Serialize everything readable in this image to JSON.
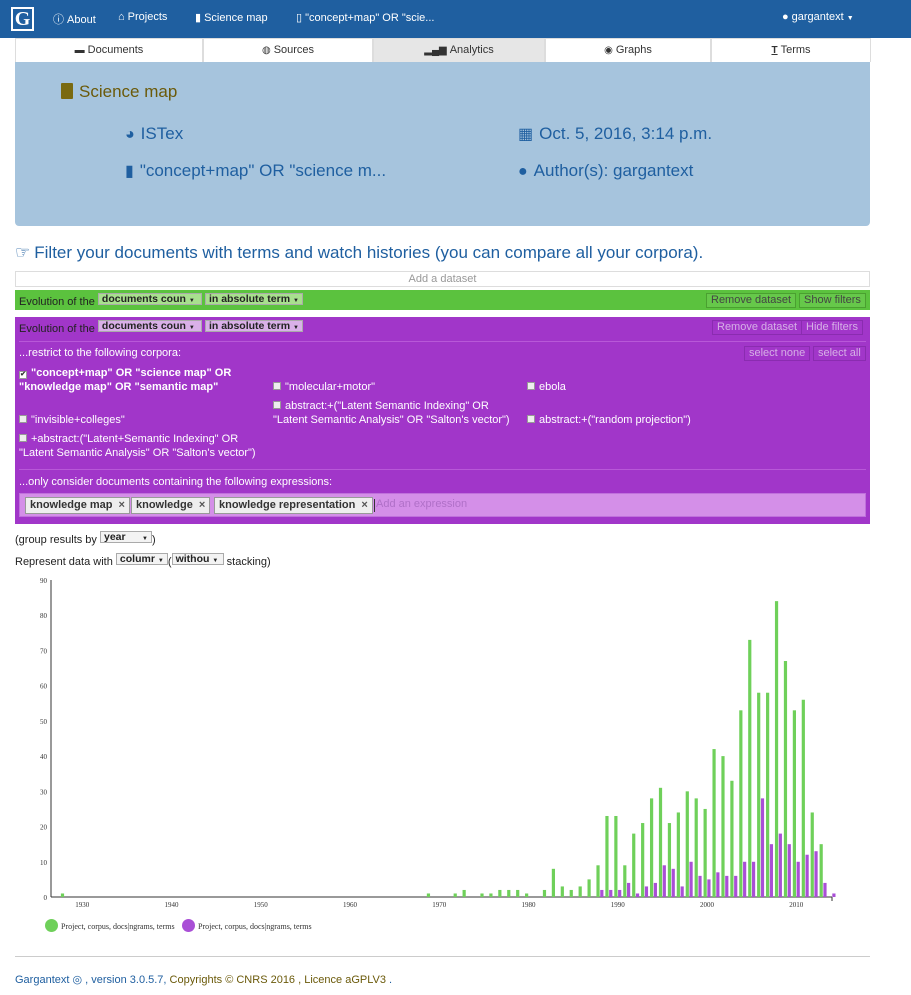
{
  "navbar": {
    "brand": "G",
    "about": "About",
    "projects": "Projects",
    "science_map": "Science map",
    "query": "\"concept+map\" OR \"scie...",
    "user": "gargantext"
  },
  "tabs": [
    {
      "label": "Documents",
      "icon": "folder-open-icon"
    },
    {
      "label": "Sources",
      "icon": "globe-icon"
    },
    {
      "label": "Analytics",
      "icon": "signal-icon"
    },
    {
      "label": "Graphs",
      "icon": "map-marker-icon"
    },
    {
      "label": "Terms",
      "icon": "text-icon"
    }
  ],
  "header": {
    "title": "Science map",
    "source": "ISTex",
    "date": "Oct. 5, 2016, 3:14 p.m.",
    "query": "\"concept+map\" OR \"science m...",
    "author": "Author(s): gargantext"
  },
  "filter": {
    "heading": "Filter your documents with terms and watch histories (you can compare all your corpora).",
    "add_dataset": "Add a dataset"
  },
  "dataset1": {
    "prefix": "Evolution of the",
    "measure": "documents coun",
    "mode": "in absolute term",
    "remove": "Remove dataset",
    "toggle": "Show filters",
    "color": "#5bc23e"
  },
  "dataset2": {
    "prefix": "Evolution of the",
    "measure": "documents coun",
    "mode": "in absolute term",
    "remove": "Remove dataset",
    "toggle": "Hide filters",
    "color": "#a136c9",
    "restrict_label": "...restrict to the following corpora:",
    "select_none": "select none",
    "select_all": "select all",
    "corpora": [
      {
        "label": "\"concept+map\" OR \"science map\" OR \"knowledge map\" OR \"semantic map\"",
        "checked": true
      },
      {
        "label": "\"molecular+motor\"",
        "checked": false
      },
      {
        "label": "ebola",
        "checked": false
      },
      {
        "label": "\"invisible+colleges\"",
        "checked": false
      },
      {
        "label": "abstract:+(\"Latent Semantic Indexing\" OR \"Latent Semantic Analysis\" OR \"Salton's vector\")",
        "checked": false
      },
      {
        "label": "abstract:+(\"random projection\")",
        "checked": false
      },
      {
        "label": "+abstract:(\"Latent+Semantic Indexing\" OR \"Latent Semantic Analysis\" OR \"Salton's vector\")",
        "checked": false
      }
    ],
    "expr_label": "...only consider documents containing the following expressions:",
    "expressions": [
      "knowledge map",
      "knowledge",
      "knowledge representation"
    ],
    "expr_placeholder": "Add an expression"
  },
  "options": {
    "group_prefix": "(group results by",
    "group_value": "year",
    "group_suffix": ")",
    "represent_prefix": "Represent data with",
    "represent_value": "columr",
    "stack_open": "(",
    "stack_value": "withou",
    "stack_suffix": "stacking)"
  },
  "chart_data": {
    "type": "bar",
    "ylim": [
      0,
      90
    ],
    "yticks": [
      0,
      10,
      20,
      30,
      40,
      50,
      60,
      70,
      80,
      90
    ],
    "xlim": [
      1926.5,
      2014
    ],
    "xticks": [
      1930,
      1940,
      1950,
      1960,
      1970,
      1980,
      1990,
      2000,
      2010
    ],
    "series": [
      {
        "name": "Project, corpus, docs|ngrams, terms",
        "color": "#6fd05a",
        "points": [
          [
            1928,
            1
          ],
          [
            1969,
            1
          ],
          [
            1972,
            1
          ],
          [
            1973,
            2
          ],
          [
            1975,
            1
          ],
          [
            1976,
            1
          ],
          [
            1977,
            2
          ],
          [
            1978,
            2
          ],
          [
            1979,
            2
          ],
          [
            1980,
            1
          ],
          [
            1982,
            2
          ],
          [
            1983,
            8
          ],
          [
            1984,
            3
          ],
          [
            1985,
            2
          ],
          [
            1986,
            3
          ],
          [
            1987,
            5
          ],
          [
            1988,
            9
          ],
          [
            1989,
            23
          ],
          [
            1990,
            23
          ],
          [
            1991,
            9
          ],
          [
            1992,
            18
          ],
          [
            1993,
            21
          ],
          [
            1994,
            28
          ],
          [
            1995,
            31
          ],
          [
            1996,
            21
          ],
          [
            1997,
            24
          ],
          [
            1998,
            30
          ],
          [
            1999,
            28
          ],
          [
            2000,
            25
          ],
          [
            2001,
            42
          ],
          [
            2002,
            40
          ],
          [
            2003,
            33
          ],
          [
            2004,
            53
          ],
          [
            2005,
            73
          ],
          [
            2006,
            58
          ],
          [
            2007,
            58
          ],
          [
            2008,
            84
          ],
          [
            2009,
            67
          ],
          [
            2010,
            53
          ],
          [
            2011,
            56
          ],
          [
            2012,
            24
          ],
          [
            2013,
            15
          ]
        ]
      },
      {
        "name": "Project, corpus, docs|ngrams, terms",
        "color": "#a94fd6",
        "points": [
          [
            1988,
            2
          ],
          [
            1989,
            2
          ],
          [
            1990,
            2
          ],
          [
            1991,
            4
          ],
          [
            1992,
            1
          ],
          [
            1993,
            3
          ],
          [
            1994,
            4
          ],
          [
            1995,
            9
          ],
          [
            1996,
            8
          ],
          [
            1997,
            3
          ],
          [
            1998,
            10
          ],
          [
            1999,
            6
          ],
          [
            2000,
            5
          ],
          [
            2001,
            7
          ],
          [
            2002,
            6
          ],
          [
            2003,
            6
          ],
          [
            2004,
            10
          ],
          [
            2005,
            10
          ],
          [
            2006,
            28
          ],
          [
            2007,
            15
          ],
          [
            2008,
            18
          ],
          [
            2009,
            15
          ],
          [
            2010,
            10
          ],
          [
            2011,
            12
          ],
          [
            2012,
            13
          ],
          [
            2013,
            4
          ],
          [
            2014,
            1
          ]
        ]
      }
    ]
  },
  "footer": {
    "app": "Gargantext",
    "version": ", version 3.0.5.7,",
    "copyright": "Copyrights",
    "org": "CNRS 2016 ,",
    "licence": "Licence aGPLV3",
    "end": "."
  }
}
